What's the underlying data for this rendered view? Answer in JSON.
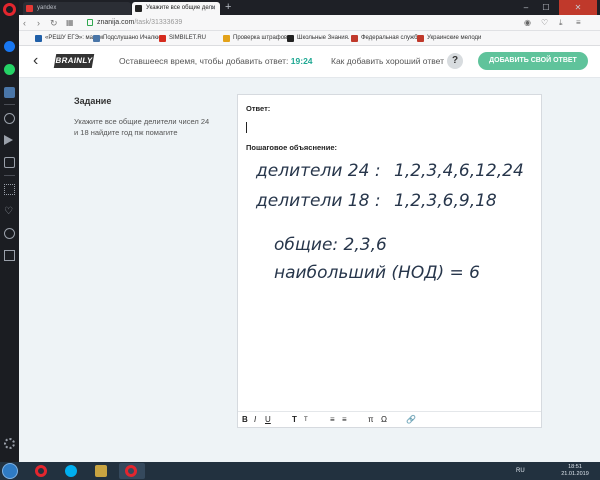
{
  "browser": {
    "tabs": [
      {
        "label": "yandex",
        "active": false
      },
      {
        "label": "Укажите все общие дели",
        "active": true
      }
    ],
    "new_tab": "+",
    "url": {
      "domain": "znanija.com",
      "path": "/task/31333639"
    },
    "window_controls": [
      "–",
      "☐",
      "✕"
    ],
    "bookmarks": [
      {
        "label": "«РЕШУ ЕГЭ»: матем",
        "color": "#1f5fa8"
      },
      {
        "label": "Подслушано Ичалки",
        "color": "#4a76a8"
      },
      {
        "label": "SIMBILET.RU",
        "color": "#d52b1e"
      },
      {
        "label": "Проверка штрафов",
        "color": "#e3a21a"
      },
      {
        "label": "Школьные Знания.",
        "color": "#222222"
      },
      {
        "label": "Федеральная служб",
        "color": "#c0392b"
      },
      {
        "label": "Украинские мелоди",
        "color": "#c0392b"
      }
    ]
  },
  "header": {
    "logo": "BRAINLY",
    "time_label": "Оставшееся время, чтобы добавить ответ:",
    "time_value": "19:24",
    "tip_label": "Как добавить хороший ответ",
    "help": "?",
    "add_answer": "ДОБАВИТЬ СВОЙ ОТВЕТ"
  },
  "task": {
    "heading": "Задание",
    "text": "Укажите все общие делители чисел 24 и 18 найдите год пж помагите"
  },
  "editor": {
    "answer_label": "Ответ:",
    "explanation_label": "Пошаговое объяснение:",
    "handwriting": {
      "line1_label": "делители 24 :",
      "line1_values": "1,2,3,4,6,12,24",
      "line2_label": "делители 18 :",
      "line2_values": "1,2,3,6,9,18",
      "line3": "общие: 2,3,6",
      "line4": "наибольший (НОД) = 6"
    },
    "toolbar": [
      "B",
      "I",
      "U",
      "T",
      "T",
      "≡",
      "≡",
      "π",
      "Ω",
      "🔗"
    ]
  },
  "taskbar": {
    "language": "RU",
    "time": "18:51",
    "date": "21.01.2019"
  },
  "colors": {
    "accent": "#1fa893",
    "button": "#5fc39b",
    "ink": "#27364b"
  }
}
